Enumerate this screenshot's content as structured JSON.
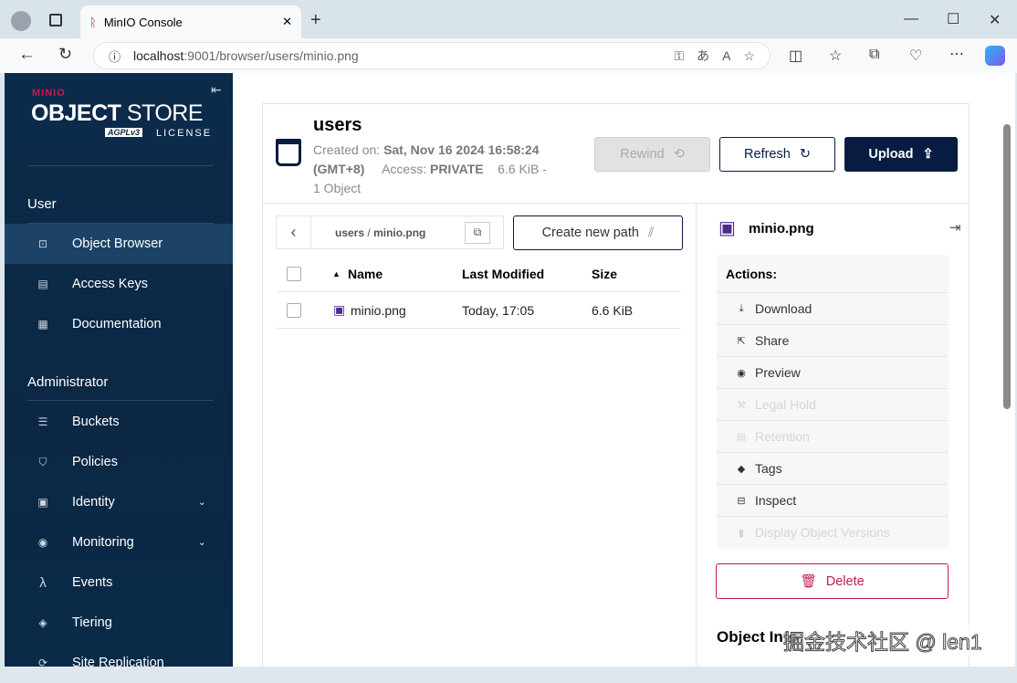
{
  "browser": {
    "tab_title": "MinIO Console",
    "url_host": "localhost",
    "url_rest": ":9001/browser/users/minio.png"
  },
  "sidebar": {
    "logo": {
      "brand": "MINIO",
      "product_bold": "OBJECT",
      "product_light": "STORE",
      "badge": "AGPLv3",
      "license": "LICENSE"
    },
    "sections": [
      {
        "title": "User",
        "items": [
          {
            "label": "Object Browser",
            "icon": "object-browser-icon",
            "active": true
          },
          {
            "label": "Access Keys",
            "icon": "key-icon"
          },
          {
            "label": "Documentation",
            "icon": "docs-icon"
          }
        ]
      },
      {
        "title": "Administrator",
        "items": [
          {
            "label": "Buckets",
            "icon": "bucket-icon"
          },
          {
            "label": "Policies",
            "icon": "shield-icon"
          },
          {
            "label": "Identity",
            "icon": "id-icon",
            "expandable": true
          },
          {
            "label": "Monitoring",
            "icon": "monitor-icon",
            "expandable": true
          },
          {
            "label": "Events",
            "icon": "lambda-icon"
          },
          {
            "label": "Tiering",
            "icon": "layers-icon"
          },
          {
            "label": "Site Replication",
            "icon": "replication-icon"
          }
        ]
      }
    ]
  },
  "bucket": {
    "name": "users",
    "created_label": "Created on:",
    "created_value": "Sat, Nov 16 2024 16:58:24",
    "tz": "(GMT+8)",
    "access_label": "Access:",
    "access_value": "PRIVATE",
    "size": "6.6 KiB -",
    "objects": "1 Object"
  },
  "toolbar": {
    "rewind": "Rewind",
    "refresh": "Refresh",
    "upload": "Upload"
  },
  "path": {
    "bucket": "users",
    "separator": "/",
    "object": "minio.png",
    "create_path": "Create new path"
  },
  "table": {
    "columns": [
      "Name",
      "Last Modified",
      "Size"
    ],
    "rows": [
      {
        "name": "minio.png",
        "modified": "Today, 17:05",
        "size": "6.6 KiB"
      }
    ]
  },
  "details": {
    "filename": "minio.png",
    "actions_title": "Actions:",
    "actions": [
      {
        "label": "Download",
        "icon": "download-icon",
        "enabled": true
      },
      {
        "label": "Share",
        "icon": "share-icon",
        "enabled": true
      },
      {
        "label": "Preview",
        "icon": "eye-icon",
        "enabled": true
      },
      {
        "label": "Legal Hold",
        "icon": "gavel-icon",
        "enabled": false
      },
      {
        "label": "Retention",
        "icon": "retention-icon",
        "enabled": false
      },
      {
        "label": "Tags",
        "icon": "tag-icon",
        "enabled": true
      },
      {
        "label": "Inspect",
        "icon": "inspect-icon",
        "enabled": true
      },
      {
        "label": "Display Object Versions",
        "icon": "versions-icon",
        "enabled": false
      }
    ],
    "delete": "Delete",
    "object_info": "Object Info"
  },
  "watermark": "掘金技术社区 @ len1",
  "colors": {
    "sidebar": "#0b2744",
    "primary": "#081c42",
    "danger": "#c51b4b"
  }
}
